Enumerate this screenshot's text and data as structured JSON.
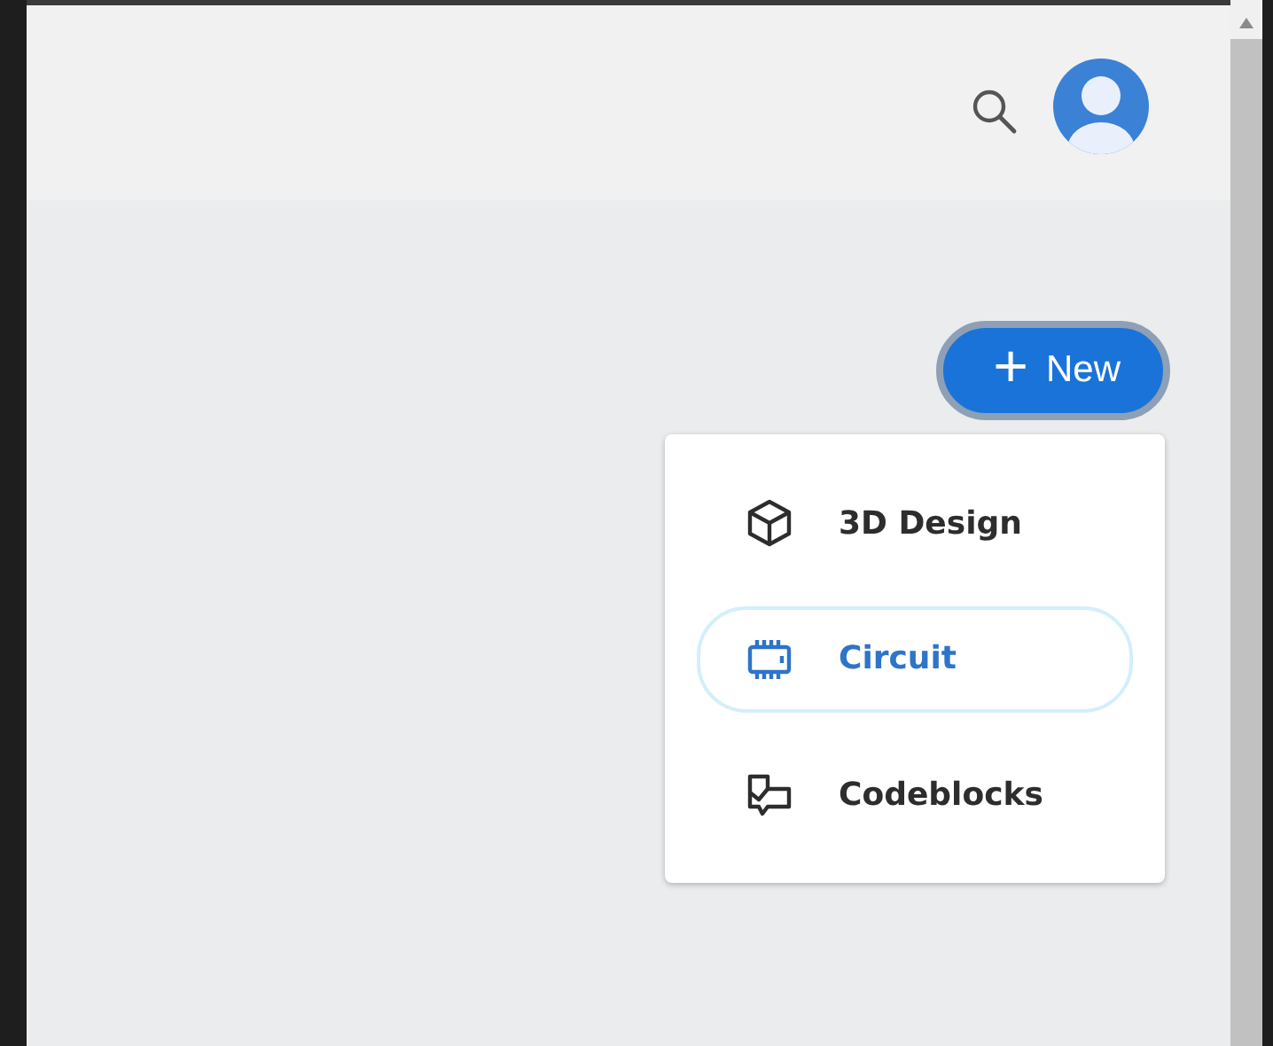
{
  "new_button": {
    "icon": "+",
    "label": "New"
  },
  "menu": [
    {
      "kind": "cube",
      "label": "3D Design",
      "selected": false
    },
    {
      "kind": "chip",
      "label": "Circuit",
      "selected": true
    },
    {
      "kind": "blocks",
      "label": "Codeblocks",
      "selected": false
    }
  ]
}
